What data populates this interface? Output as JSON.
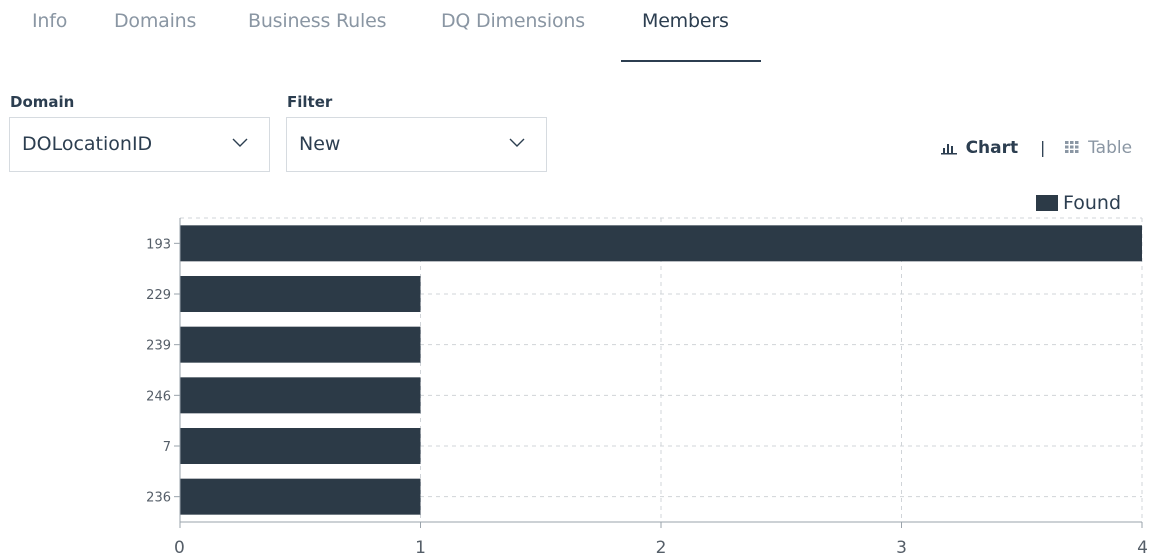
{
  "tabs": [
    {
      "label": "Info",
      "active": false
    },
    {
      "label": "Domains",
      "active": false
    },
    {
      "label": "Business Rules",
      "active": false
    },
    {
      "label": "DQ Dimensions",
      "active": false
    },
    {
      "label": "Members",
      "active": true
    }
  ],
  "filters": {
    "domain": {
      "label": "Domain",
      "value": "DOLocationID"
    },
    "filter": {
      "label": "Filter",
      "value": "New"
    }
  },
  "view_toggle": {
    "chart_label": "Chart",
    "separator": "|",
    "table_label": "Table",
    "active": "chart"
  },
  "colors": {
    "bar": "#2c3a47",
    "grid": "#d0d4d8",
    "text": "#2c3e50",
    "muted": "#8a96a3"
  },
  "chart_data": {
    "type": "bar",
    "orientation": "horizontal",
    "categories": [
      "193",
      "229",
      "239",
      "246",
      "7",
      "236"
    ],
    "series": [
      {
        "name": "Found",
        "values": [
          4,
          1,
          1,
          1,
          1,
          1
        ]
      }
    ],
    "xlim": [
      0,
      4
    ],
    "xticks": [
      "0",
      "1",
      "2",
      "3",
      "4"
    ],
    "grid": true,
    "legend": "top-right"
  }
}
